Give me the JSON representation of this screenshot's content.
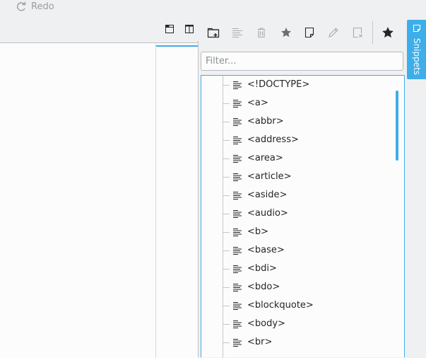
{
  "topbar": {
    "redo_label": "Redo"
  },
  "filter": {
    "placeholder": "Filter..."
  },
  "snippets_tab": {
    "label": "Snippets"
  },
  "snippets": [
    "<!DOCTYPE>",
    "<a>",
    "<abbr>",
    "<address>",
    "<area>",
    "<article>",
    "<aside>",
    "<audio>",
    "<b>",
    "<base>",
    "<bdi>",
    "<bdo>",
    "<blockquote>",
    "<body>",
    "<br>"
  ],
  "colors": {
    "accent": "#3daee9",
    "background": "#eff0f1",
    "text": "#232627"
  }
}
